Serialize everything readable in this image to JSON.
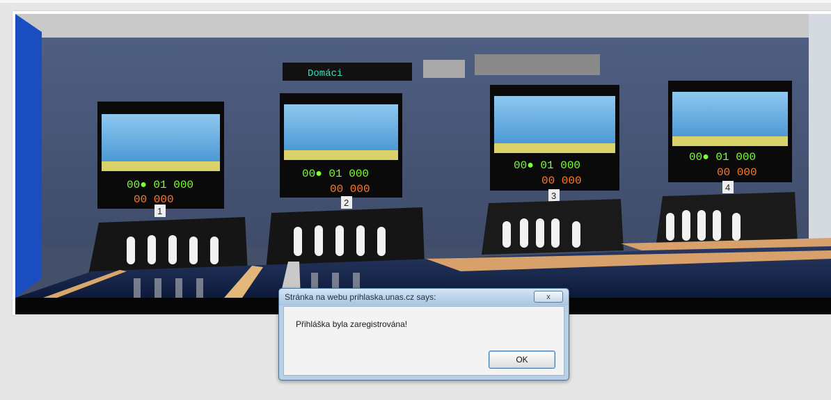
{
  "photo": {
    "description_icon": "bowling-alley-photo",
    "lane_numbers": [
      "1",
      "2",
      "3",
      "4"
    ]
  },
  "dialog": {
    "title": "Stránka na webu prihlaska.unas.cz says:",
    "close_label": "x",
    "message": "Přihláška byla zaregistrována!",
    "ok_label": "OK"
  },
  "colors": {
    "wall": "#4a5878",
    "dialog_frame": "#b7d0e8",
    "dialog_body": "#f3f3f3"
  }
}
